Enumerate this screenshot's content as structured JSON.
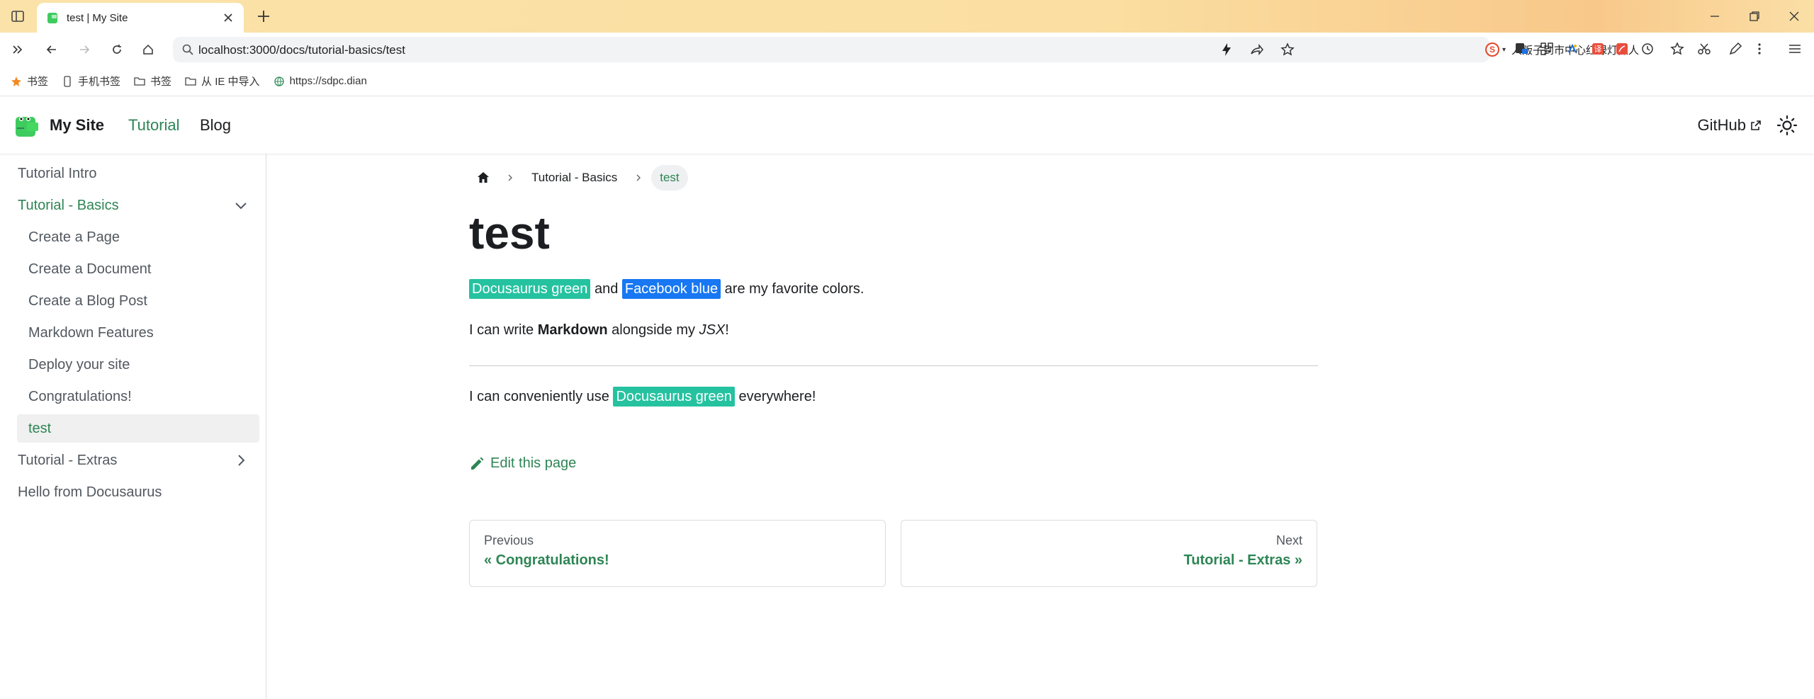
{
  "browser": {
    "tab_title": "test | My Site",
    "url": "localhost:3000/docs/tutorial-basics/test",
    "search_box_text": "人贩子到市中心红绿灯抓人",
    "bookmarks": [
      "书签",
      "手机书签",
      "书签",
      "从 IE 中导入",
      "https://sdpc.dian"
    ]
  },
  "navbar": {
    "brand": "My Site",
    "links": [
      "Tutorial",
      "Blog"
    ],
    "github": "GitHub"
  },
  "sidebar": {
    "items": [
      {
        "label": "Tutorial Intro"
      },
      {
        "label": "Tutorial - Basics"
      },
      {
        "label": "Create a Page"
      },
      {
        "label": "Create a Document"
      },
      {
        "label": "Create a Blog Post"
      },
      {
        "label": "Markdown Features"
      },
      {
        "label": "Deploy your site"
      },
      {
        "label": "Congratulations!"
      },
      {
        "label": "test"
      },
      {
        "label": "Tutorial - Extras"
      },
      {
        "label": "Hello from Docusaurus"
      }
    ]
  },
  "breadcrumbs": [
    "Tutorial - Basics",
    "test"
  ],
  "doc": {
    "title": "test",
    "p1": {
      "hl1": "Docusaurus green",
      "and": " and ",
      "hl2": "Facebook blue",
      "rest": " are my favorite colors."
    },
    "p2": {
      "pre": "I can write ",
      "bold": "Markdown",
      "mid": " alongside my ",
      "italic": "JSX",
      "post": "!"
    },
    "p3": {
      "pre": "I can conveniently use ",
      "hl": "Docusaurus green",
      "post": " everywhere!"
    },
    "edit": "Edit this page"
  },
  "pager": {
    "prev": {
      "sub": "Previous",
      "label": "« Congratulations!"
    },
    "next": {
      "sub": "Next",
      "label": "Tutorial - Extras »"
    }
  },
  "colors": {
    "primary": "#2e8555",
    "docusaurus_green": "#25c2a0",
    "facebook_blue": "#1877f2"
  }
}
